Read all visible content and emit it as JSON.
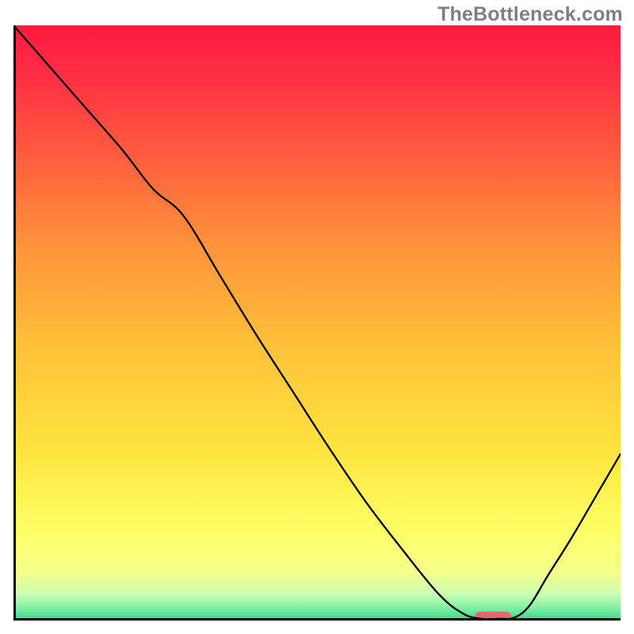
{
  "watermark": "TheBottleneck.com",
  "chart_data": {
    "type": "line",
    "title": "",
    "xlabel": "",
    "ylabel": "",
    "xlim": [
      0,
      100
    ],
    "ylim": [
      0,
      100
    ],
    "gradient_stops": [
      {
        "offset": 0.0,
        "color": "#ff1a40"
      },
      {
        "offset": 0.08,
        "color": "#ff2d44"
      },
      {
        "offset": 0.22,
        "color": "#ff5d3e"
      },
      {
        "offset": 0.38,
        "color": "#ff963a"
      },
      {
        "offset": 0.55,
        "color": "#ffc33a"
      },
      {
        "offset": 0.72,
        "color": "#ffe540"
      },
      {
        "offset": 0.85,
        "color": "#ffff66"
      },
      {
        "offset": 0.92,
        "color": "#f2ff8a"
      },
      {
        "offset": 0.955,
        "color": "#ccffb3"
      },
      {
        "offset": 0.975,
        "color": "#8ef2a8"
      },
      {
        "offset": 1.0,
        "color": "#33d989"
      }
    ],
    "series": [
      {
        "name": "bottleneck-curve",
        "color": "#000000",
        "width": 2.3,
        "x": [
          0,
          6,
          12,
          18,
          23,
          28,
          34,
          40,
          46,
          52,
          58,
          64,
          70,
          74,
          77,
          80,
          82.5,
          85,
          88,
          92,
          96,
          100
        ],
        "y": [
          100,
          93,
          86,
          79,
          72.5,
          68,
          58,
          48,
          38.5,
          29,
          20,
          12,
          4.5,
          1.2,
          0.3,
          0.3,
          0.5,
          2.5,
          7.5,
          14,
          21,
          28
        ]
      }
    ],
    "marker": {
      "name": "optimal-range",
      "color": "#e2686b",
      "x_start": 76,
      "x_end": 82,
      "y": 0.6,
      "thickness_pct": 1.8
    },
    "axes": {
      "color": "#000000",
      "width": 3
    }
  }
}
